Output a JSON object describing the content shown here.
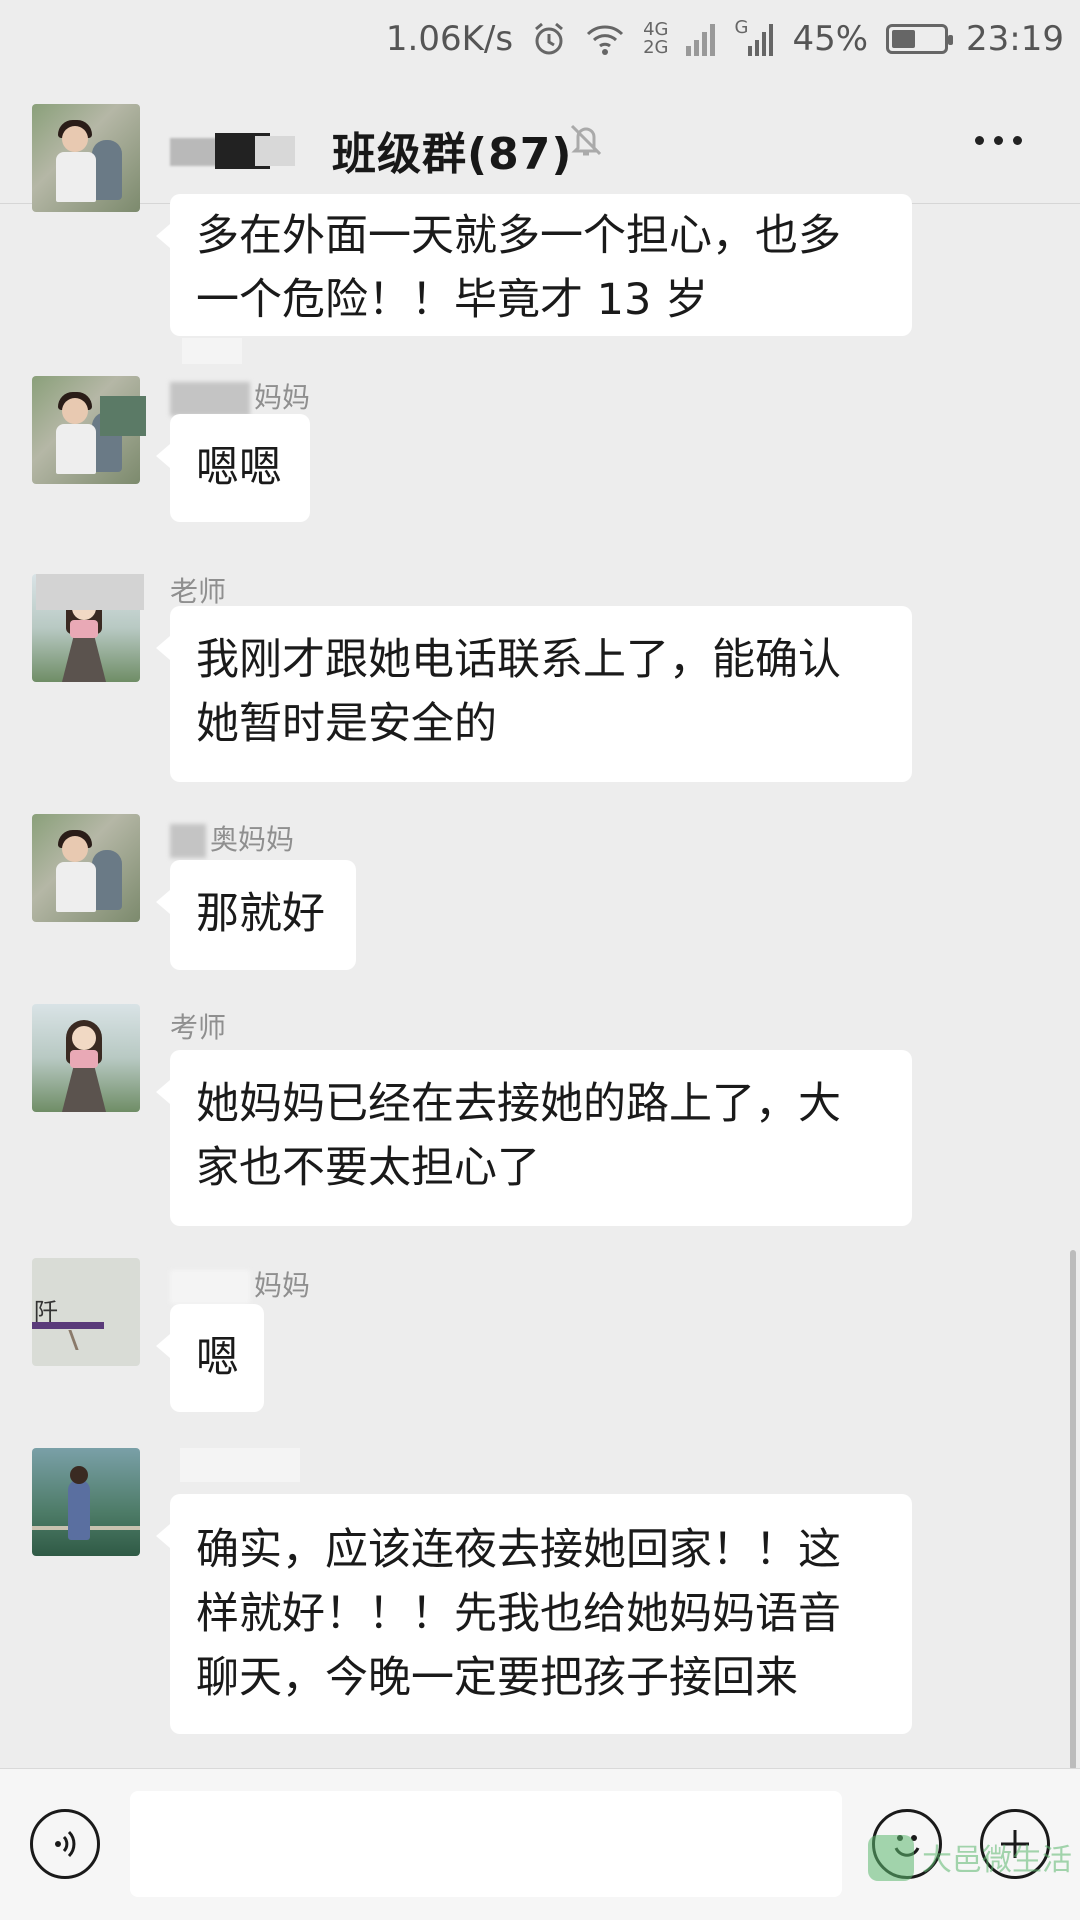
{
  "status_bar": {
    "speed": "1.06K/s",
    "net_top": "4G",
    "net_bottom": "2G",
    "sim_label": "G",
    "battery_percent": "45%",
    "battery_level": 0.45,
    "time": "23:19"
  },
  "header": {
    "title": "班级群(87)"
  },
  "messages": [
    {
      "sender": "",
      "lines": [
        "多在外面一天就多一个担心，也多",
        "一个危险！！毕竟才 13 岁"
      ]
    },
    {
      "sender": "妈妈",
      "lines": [
        "嗯嗯"
      ]
    },
    {
      "sender": "老师",
      "lines": [
        "我刚才跟她电话联系上了，能确认",
        "她暂时是安全的"
      ]
    },
    {
      "sender": "奥妈妈",
      "lines": [
        "那就好"
      ]
    },
    {
      "sender": "考师",
      "lines": [
        "她妈妈已经在去接她的路上了，大",
        "家也不要太担心了"
      ]
    },
    {
      "sender": "妈妈",
      "lines": [
        "嗯"
      ]
    },
    {
      "sender": "",
      "lines": [
        "确实，应该连夜去接她回家！！这",
        "样就好！！！先我也给她妈妈语音",
        "聊天，今晚一定要把孩子接回来"
      ]
    }
  ],
  "avatars": {
    "pt_text": "阡"
  },
  "input_bar": {
    "placeholder": ""
  },
  "watermark": {
    "text": "大邑微生活"
  },
  "icons": [
    "signal-icon",
    "alarm-icon",
    "wifi-icon",
    "battery-icon",
    "mute-icon",
    "more-icon",
    "voice-icon",
    "emoji-icon",
    "plus-icon"
  ]
}
